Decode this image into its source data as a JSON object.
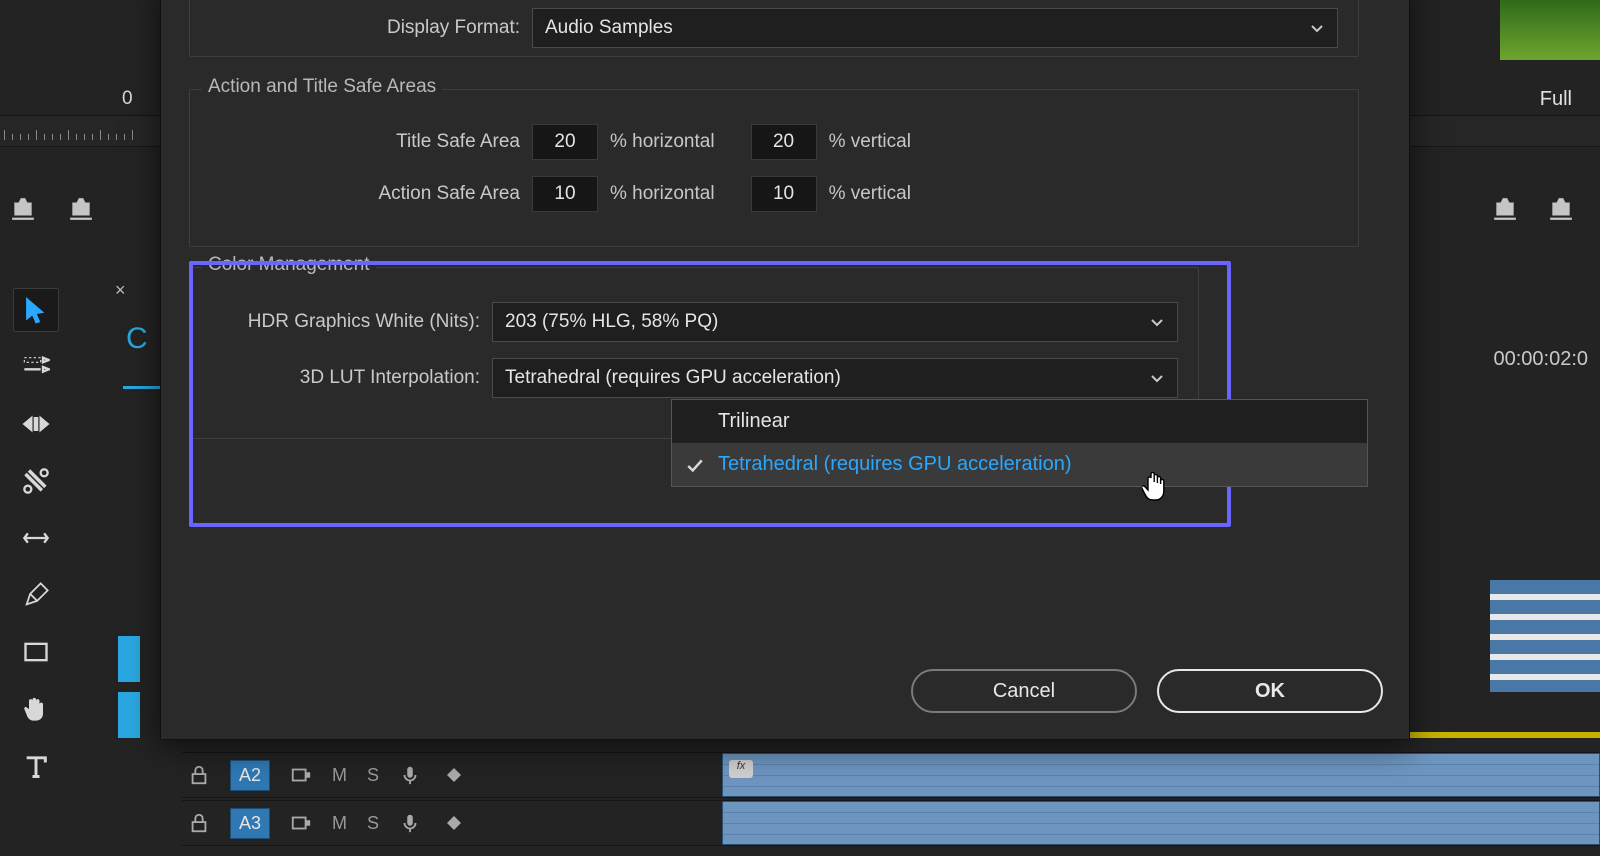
{
  "workspace": {
    "zero_label": "0",
    "full_label": "Full",
    "timecode_right": "00:00:02:0"
  },
  "toolbar": {
    "tools": [
      "selection",
      "track-select",
      "ripple-edit",
      "razor",
      "slip",
      "pen",
      "rectangle",
      "hand",
      "type"
    ]
  },
  "timeline": {
    "tracks": [
      {
        "id": "A2",
        "letters": [
          "M",
          "S"
        ]
      },
      {
        "id": "A3",
        "letters": [
          "M",
          "S"
        ]
      }
    ],
    "fx_label": "fx"
  },
  "dialog": {
    "display_format": {
      "label": "Display Format:",
      "value": "Audio Samples"
    },
    "safe_areas": {
      "legend": "Action and Title Safe Areas",
      "title_label": "Title Safe Area",
      "action_label": "Action Safe Area",
      "title_h": "20",
      "title_v": "20",
      "action_h": "10",
      "action_v": "10",
      "pct_h": "% horizontal",
      "pct_v": "% vertical"
    },
    "color_mgmt": {
      "legend": "Color Management",
      "hdr_label": "HDR Graphics White (Nits):",
      "hdr_value": "203 (75% HLG, 58% PQ)",
      "lut_label": "3D LUT Interpolation:",
      "lut_value": "Tetrahedral (requires GPU acceleration)",
      "options": [
        "Trilinear",
        "Tetrahedral (requires GPU acceleration)"
      ]
    },
    "buttons": {
      "cancel": "Cancel",
      "ok": "OK"
    }
  }
}
